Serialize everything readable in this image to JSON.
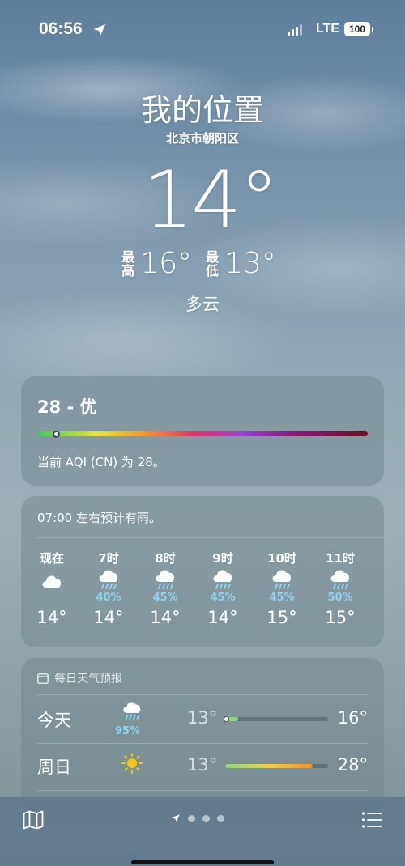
{
  "status_bar": {
    "time": "06:56",
    "network": "LTE",
    "battery": "100"
  },
  "header": {
    "city": "我的位置",
    "district": "北京市朝阳区",
    "current_temp": "14°",
    "high_label": "最高",
    "high": "16°",
    "low_label": "最低",
    "low": "13°",
    "condition": "多云"
  },
  "aqi": {
    "title": "28 - 优",
    "description": "当前 AQI (CN) 为 28。",
    "level_fraction": 0.06
  },
  "hourly": {
    "message": "07:00 左右预计有雨。",
    "items": [
      {
        "hour": "现在",
        "icon": "cloud-icon",
        "pct": "",
        "temp": "14°"
      },
      {
        "hour": "7时",
        "icon": "rain-cloud-icon",
        "pct": "40%",
        "temp": "14°"
      },
      {
        "hour": "8时",
        "icon": "rain-cloud-icon",
        "pct": "45%",
        "temp": "14°"
      },
      {
        "hour": "9时",
        "icon": "rain-cloud-icon",
        "pct": "45%",
        "temp": "14°"
      },
      {
        "hour": "10时",
        "icon": "rain-cloud-icon",
        "pct": "45%",
        "temp": "15°"
      },
      {
        "hour": "11时",
        "icon": "rain-cloud-icon",
        "pct": "50%",
        "temp": "15°"
      }
    ]
  },
  "daily": {
    "title": "每日天气预报",
    "days": [
      {
        "name": "今天",
        "icon": "rain-cloud-icon",
        "pct": "95%",
        "low": "13°",
        "high": "16°"
      },
      {
        "name": "周日",
        "icon": "sun-icon",
        "pct": "",
        "low": "13°",
        "high": "28°"
      }
    ]
  },
  "colors": {
    "precip_blue": "#8fd3f0",
    "sun_yellow": "#f5c518"
  }
}
